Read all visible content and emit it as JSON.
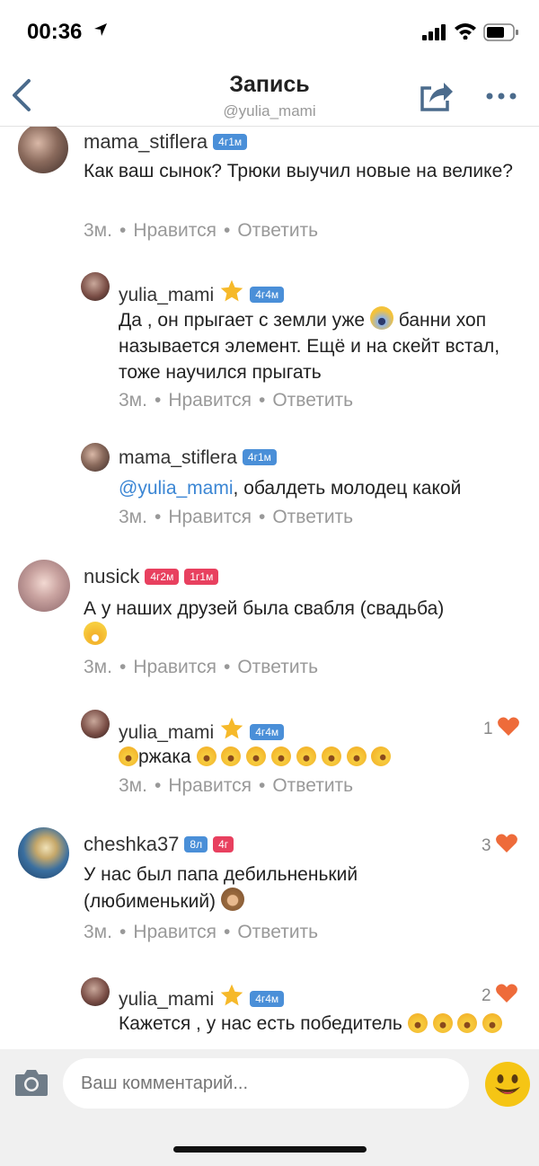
{
  "status": {
    "time": "00:36"
  },
  "nav": {
    "title": "Запись",
    "subtitle": "@yulia_mami"
  },
  "comments": [
    {
      "user": "mama_stiflera",
      "badges": [
        "4г1м"
      ],
      "text": "Как ваш сынок? Трюки выучил новые на велике?",
      "age": "3м.",
      "like": "Нравится",
      "reply": "Ответить"
    },
    {
      "user": "yulia_mami",
      "badges": [
        "4г4м"
      ],
      "text_a": "Да , он прыгает с земли уже",
      "text_b": "банни хоп называется элемент.  Ещё и на скейт встал, тоже научился прыгать",
      "age": "3м.",
      "like": "Нравится",
      "reply": "Ответить"
    },
    {
      "user": "mama_stiflera",
      "badges": [
        "4г1м"
      ],
      "mention": "@yulia_mami",
      "text": ", обалдеть молодец какой",
      "age": "3м.",
      "like": "Нравится",
      "reply": "Ответить"
    },
    {
      "user": "nusick",
      "badges": [
        "4г2м",
        "1г1м"
      ],
      "text": "А у наших друзей была свабля (свадьба)",
      "age": "3м.",
      "like": "Нравится",
      "reply": "Ответить"
    },
    {
      "user": "yulia_mami",
      "badges": [
        "4г4м"
      ],
      "text": "ржака",
      "likes": "1",
      "age": "3м.",
      "like": "Нравится",
      "reply": "Ответить"
    },
    {
      "user": "cheshka37",
      "badges": [
        "8л",
        "4г"
      ],
      "text": "У нас был папа дебильненький (любименький)",
      "likes": "3",
      "age": "3м.",
      "like": "Нравится",
      "reply": "Ответить"
    },
    {
      "user": "yulia_mami",
      "badges": [
        "4г4м"
      ],
      "text": "Кажется , у нас есть победитель",
      "likes": "2"
    }
  ],
  "input": {
    "placeholder": "Ваш комментарий..."
  },
  "colors": {
    "accent": "#4a8fd8",
    "pink": "#e8405f",
    "heart": "#ee6b3a"
  }
}
